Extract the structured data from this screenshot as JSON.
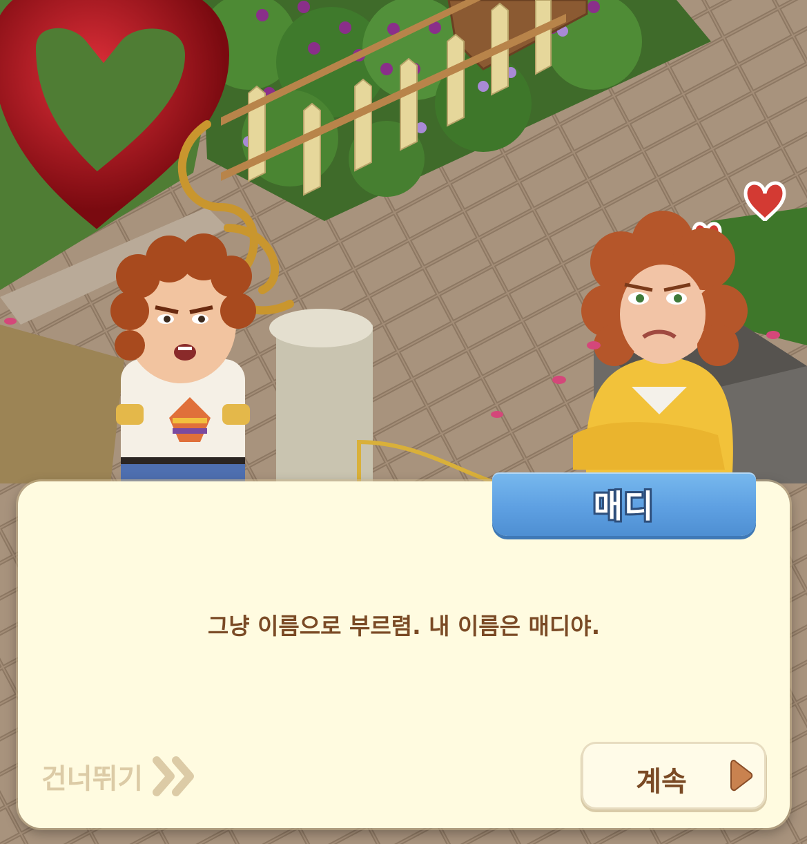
{
  "scene": {
    "characters": [
      {
        "id": "boy",
        "description_icon": "curly-haired-boy-character"
      },
      {
        "id": "maddie",
        "description_icon": "maddie-character"
      }
    ],
    "colors": {
      "pavement": "#a38d77",
      "grass": "#4f7d34",
      "rose_red": "#b3151c",
      "wood": "#8b5a32"
    }
  },
  "dialog": {
    "speaker": "매디",
    "text": "그냥 이름으로 부르렴. 내 이름은 매디야.",
    "skip_label": "건너뛰기",
    "continue_label": "계속",
    "colors": {
      "panel": "#fffbe0",
      "text": "#7a4a25",
      "name_tag": "#5ea0e2",
      "skip": "#dccba6",
      "arrow": "#c9824f"
    }
  }
}
